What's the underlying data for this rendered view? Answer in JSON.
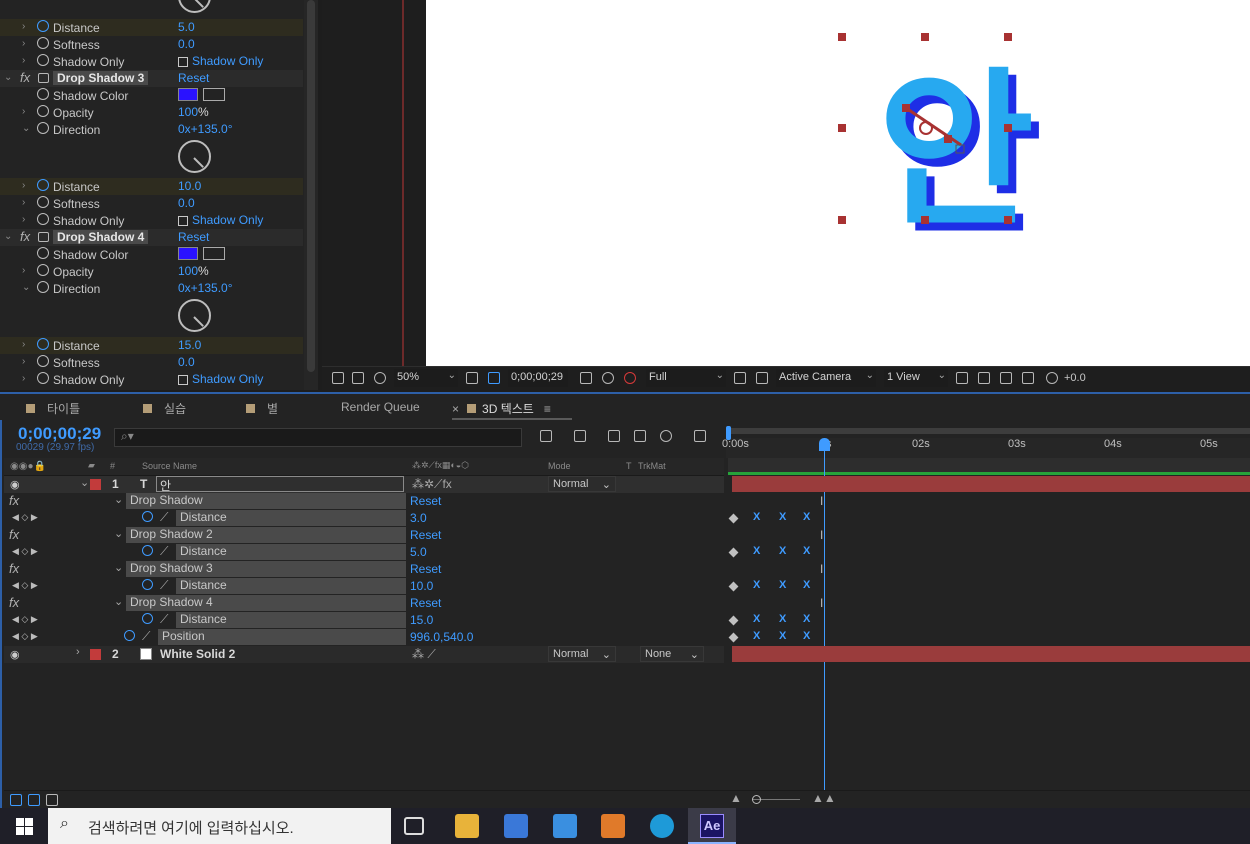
{
  "effect_controls": {
    "rows": [
      {
        "label": "Distance",
        "value": "5.0"
      },
      {
        "label": "Softness",
        "value": "0.0"
      },
      {
        "label": "Shadow Only",
        "value": "Shadow Only"
      },
      {
        "name": "Drop Shadow 3",
        "reset": "Reset"
      },
      {
        "label": "Shadow Color"
      },
      {
        "label": "Opacity",
        "value": "100",
        "unit": "%"
      },
      {
        "label": "Direction",
        "value": "0x+135.0°"
      },
      {
        "label": "Distance",
        "value": "10.0"
      },
      {
        "label": "Softness",
        "value": "0.0"
      },
      {
        "label": "Shadow Only",
        "value": "Shadow Only"
      },
      {
        "name": "Drop Shadow 4",
        "reset": "Reset"
      },
      {
        "label": "Shadow Color"
      },
      {
        "label": "Opacity",
        "value": "100",
        "unit": "%"
      },
      {
        "label": "Direction",
        "value": "0x+135.0°"
      },
      {
        "label": "Distance",
        "value": "15.0"
      },
      {
        "label": "Softness",
        "value": "0.0"
      },
      {
        "label": "Shadow Only",
        "value": "Shadow Only"
      }
    ],
    "fx_label": "fx",
    "shadow_color": "#2a12ff"
  },
  "viewer": {
    "glyph": "안",
    "glyph_color": "#27a9f0",
    "extrude_color": "#1e2ee6",
    "zoom": "50%",
    "timecode": "0;00;00;29",
    "resolution": "Full",
    "camera": "Active Camera",
    "views": "1 View",
    "exposure": "+0.0"
  },
  "tabs": [
    {
      "label": "타이틀"
    },
    {
      "label": "실습"
    },
    {
      "label": "별"
    },
    {
      "label": "Render Queue"
    },
    {
      "label": "3D 텍스트",
      "active": true
    }
  ],
  "timeline": {
    "timecode": "0;00;00;29",
    "fps": "00029 (29.97 fps)",
    "search_placeholder": "⌕▾",
    "columns": {
      "num": "#",
      "source": "Source Name",
      "mode": "Mode",
      "t": "T",
      "trkmat": "TrkMat"
    },
    "ruler": [
      "0:00s",
      "02s",
      "03s",
      "04s",
      "05s"
    ],
    "ruler_playhead_label": "s",
    "layers": [
      {
        "num": "1",
        "type_icon": "T",
        "name": "안",
        "mode": "Normal"
      },
      {
        "num": "2",
        "name": "White Solid 2",
        "mode": "Normal",
        "trkmat": "None"
      }
    ],
    "sub_rows": [
      {
        "name": "Drop Shadow",
        "reset": "Reset"
      },
      {
        "name": "Distance",
        "value": "3.0"
      },
      {
        "name": "Drop Shadow 2",
        "reset": "Reset"
      },
      {
        "name": "Distance",
        "value": "5.0"
      },
      {
        "name": "Drop Shadow 3",
        "reset": "Reset"
      },
      {
        "name": "Distance",
        "value": "10.0"
      },
      {
        "name": "Drop Shadow 4",
        "reset": "Reset"
      },
      {
        "name": "Distance",
        "value": "15.0"
      },
      {
        "name": "Position",
        "value": "996.0,540.0"
      }
    ],
    "kf_glyph": "X",
    "ibeam": "I"
  },
  "taskbar": {
    "search_text": "검색하려면 여기에 입력하십시오.",
    "ae_label": "Ae"
  }
}
